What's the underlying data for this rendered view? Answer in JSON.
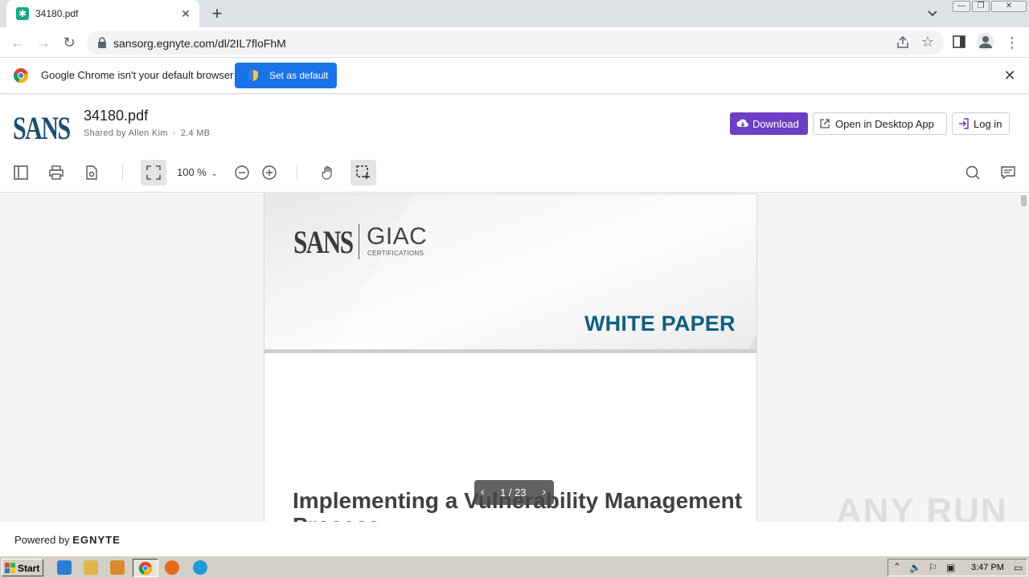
{
  "browser": {
    "tab_title": "34180.pdf",
    "url": "sansorg.egnyte.com/dl/2IL7floFhM"
  },
  "infobar": {
    "message": "Google Chrome isn't your default browser",
    "set_default_label": "Set as default"
  },
  "header": {
    "logo_text": "SANS",
    "file_name": "34180.pdf",
    "shared_by": "Shared by Allen Kim",
    "size": "2.4 MB",
    "download_label": "Download",
    "desktop_label": "Open in Desktop App",
    "login_label": "Log in",
    "accent_color": "#6d3fc5"
  },
  "viewer": {
    "zoom": "100 %"
  },
  "document": {
    "sans": "SANS",
    "giac": "GIAC",
    "giac_sub": "CERTIFICATIONS",
    "label": "WHITE PAPER",
    "title": "Implementing a Vulnerability Management Process",
    "pager": "1 / 23"
  },
  "footer": {
    "powered_by": "Powered by",
    "brand": "EGNYTE"
  },
  "watermark": "ANY RUN",
  "taskbar": {
    "start_label": "Start",
    "clock": "3:47 PM"
  }
}
